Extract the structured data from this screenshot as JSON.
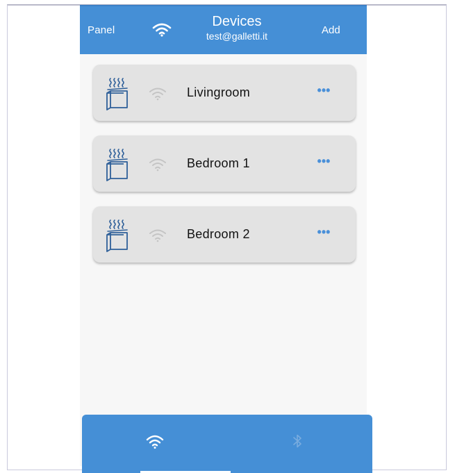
{
  "header": {
    "left_label": "Panel",
    "title": "Devices",
    "subtitle": "test@galletti.it",
    "right_label": "Add",
    "status_icon": "wifi-icon"
  },
  "devices": [
    {
      "name": "Livingroom",
      "type_icon": "heater-icon",
      "signal_icon": "wifi-icon",
      "menu_label": "•••"
    },
    {
      "name": "Bedroom 1",
      "type_icon": "heater-icon",
      "signal_icon": "wifi-icon",
      "menu_label": "•••"
    },
    {
      "name": "Bedroom 2",
      "type_icon": "heater-icon",
      "signal_icon": "wifi-icon",
      "menu_label": "•••"
    }
  ],
  "tabs": [
    {
      "id": "wifi",
      "icon": "wifi-icon",
      "active": true
    },
    {
      "id": "bluetooth",
      "icon": "bluetooth-icon",
      "active": false
    }
  ],
  "colors": {
    "accent": "#458fd6",
    "card_bg": "#e3e3e3",
    "heater_icon": "#2e5f99",
    "inactive_signal": "#bdbdbd",
    "menu_dots": "#4a90d9"
  }
}
